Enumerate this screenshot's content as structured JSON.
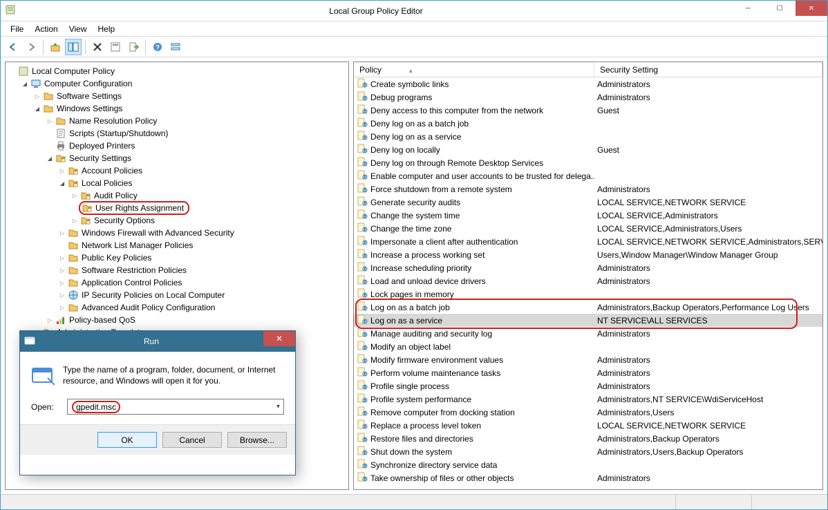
{
  "window": {
    "title": "Local Group Policy Editor",
    "menus": [
      "File",
      "Action",
      "View",
      "Help"
    ]
  },
  "tree": [
    {
      "depth": 0,
      "tw": "none",
      "icon": "mmc",
      "label": "Local Computer Policy"
    },
    {
      "depth": 1,
      "tw": "open",
      "icon": "computer",
      "label": "Computer Configuration"
    },
    {
      "depth": 2,
      "tw": "closed",
      "icon": "folder",
      "label": "Software Settings"
    },
    {
      "depth": 2,
      "tw": "open",
      "icon": "folder",
      "label": "Windows Settings"
    },
    {
      "depth": 3,
      "tw": "closed",
      "icon": "folder",
      "label": "Name Resolution Policy"
    },
    {
      "depth": 3,
      "tw": "none",
      "icon": "script",
      "label": "Scripts (Startup/Shutdown)"
    },
    {
      "depth": 3,
      "tw": "none",
      "icon": "printer",
      "label": "Deployed Printers"
    },
    {
      "depth": 3,
      "tw": "open",
      "icon": "folder-lock",
      "label": "Security Settings"
    },
    {
      "depth": 4,
      "tw": "closed",
      "icon": "folder-lock",
      "label": "Account Policies"
    },
    {
      "depth": 4,
      "tw": "open",
      "icon": "folder-lock",
      "label": "Local Policies"
    },
    {
      "depth": 5,
      "tw": "closed",
      "icon": "folder-lock",
      "label": "Audit Policy"
    },
    {
      "depth": 5,
      "tw": "none",
      "icon": "folder-lock",
      "label": "User Rights Assignment",
      "hl": true
    },
    {
      "depth": 5,
      "tw": "closed",
      "icon": "folder-lock",
      "label": "Security Options"
    },
    {
      "depth": 4,
      "tw": "closed",
      "icon": "folder",
      "label": "Windows Firewall with Advanced Security"
    },
    {
      "depth": 4,
      "tw": "none",
      "icon": "folder",
      "label": "Network List Manager Policies"
    },
    {
      "depth": 4,
      "tw": "closed",
      "icon": "folder",
      "label": "Public Key Policies"
    },
    {
      "depth": 4,
      "tw": "closed",
      "icon": "folder",
      "label": "Software Restriction Policies"
    },
    {
      "depth": 4,
      "tw": "closed",
      "icon": "folder",
      "label": "Application Control Policies"
    },
    {
      "depth": 4,
      "tw": "closed",
      "icon": "ipsec",
      "label": "IP Security Policies on Local Computer"
    },
    {
      "depth": 4,
      "tw": "closed",
      "icon": "folder",
      "label": "Advanced Audit Policy Configuration"
    },
    {
      "depth": 3,
      "tw": "closed",
      "icon": "qos",
      "label": "Policy-based QoS"
    },
    {
      "depth": 2,
      "tw": "closed",
      "icon": "folder",
      "label": "Administrative Templates"
    }
  ],
  "list": {
    "headers": {
      "policy": "Policy",
      "setting": "Security Setting"
    },
    "rows": [
      {
        "p": "Create symbolic links",
        "s": "Administrators"
      },
      {
        "p": "Debug programs",
        "s": "Administrators"
      },
      {
        "p": "Deny access to this computer from the network",
        "s": "Guest"
      },
      {
        "p": "Deny log on as a batch job",
        "s": ""
      },
      {
        "p": "Deny log on as a service",
        "s": ""
      },
      {
        "p": "Deny log on locally",
        "s": "Guest"
      },
      {
        "p": "Deny log on through Remote Desktop Services",
        "s": ""
      },
      {
        "p": "Enable computer and user accounts to be trusted for delega...",
        "s": ""
      },
      {
        "p": "Force shutdown from a remote system",
        "s": "Administrators"
      },
      {
        "p": "Generate security audits",
        "s": "LOCAL SERVICE,NETWORK SERVICE"
      },
      {
        "p": "Change the system time",
        "s": "LOCAL SERVICE,Administrators"
      },
      {
        "p": "Change the time zone",
        "s": "LOCAL SERVICE,Administrators,Users"
      },
      {
        "p": "Impersonate a client after authentication",
        "s": "LOCAL SERVICE,NETWORK SERVICE,Administrators,SERVICE"
      },
      {
        "p": "Increase a process working set",
        "s": "Users,Window Manager\\Window Manager Group"
      },
      {
        "p": "Increase scheduling priority",
        "s": "Administrators"
      },
      {
        "p": "Load and unload device drivers",
        "s": "Administrators"
      },
      {
        "p": "Lock pages in memory",
        "s": ""
      },
      {
        "p": "Log on as a batch job",
        "s": "Administrators,Backup Operators,Performance Log Users"
      },
      {
        "p": "Log on as a service",
        "s": "NT SERVICE\\ALL SERVICES",
        "sel": true
      },
      {
        "p": "Manage auditing and security log",
        "s": "Administrators"
      },
      {
        "p": "Modify an object label",
        "s": ""
      },
      {
        "p": "Modify firmware environment values",
        "s": "Administrators"
      },
      {
        "p": "Perform volume maintenance tasks",
        "s": "Administrators"
      },
      {
        "p": "Profile single process",
        "s": "Administrators"
      },
      {
        "p": "Profile system performance",
        "s": "Administrators,NT SERVICE\\WdiServiceHost"
      },
      {
        "p": "Remove computer from docking station",
        "s": "Administrators,Users"
      },
      {
        "p": "Replace a process level token",
        "s": "LOCAL SERVICE,NETWORK SERVICE"
      },
      {
        "p": "Restore files and directories",
        "s": "Administrators,Backup Operators"
      },
      {
        "p": "Shut down the system",
        "s": "Administrators,Users,Backup Operators"
      },
      {
        "p": "Synchronize directory service data",
        "s": ""
      },
      {
        "p": "Take ownership of files or other objects",
        "s": "Administrators"
      }
    ],
    "hl_row_index": 18
  },
  "run": {
    "title": "Run",
    "text": "Type the name of a program, folder, document, or Internet resource, and Windows will open it for you.",
    "open_label": "Open:",
    "value": "gpedit.msc",
    "buttons": {
      "ok": "OK",
      "cancel": "Cancel",
      "browse": "Browse..."
    }
  }
}
